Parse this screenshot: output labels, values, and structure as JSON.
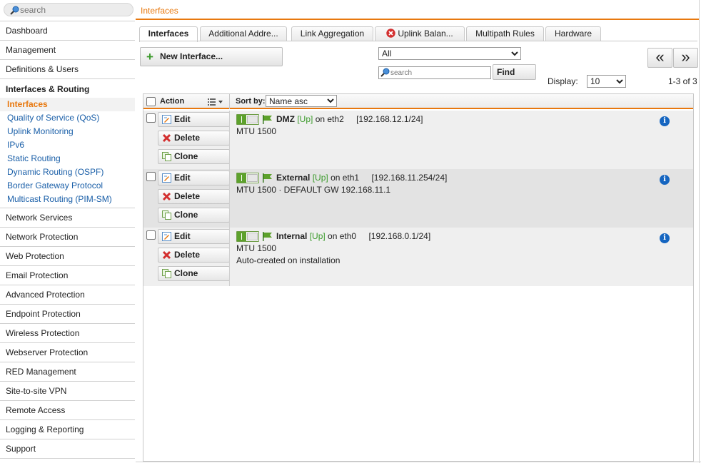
{
  "search": {
    "placeholder": "search"
  },
  "header": {
    "title": "Interfaces"
  },
  "sidebar": {
    "items_top": [
      {
        "label": "Dashboard"
      },
      {
        "label": "Management"
      },
      {
        "label": "Definitions & Users"
      }
    ],
    "group": {
      "label": "Interfaces & Routing",
      "subitems": [
        {
          "label": "Interfaces",
          "active": true
        },
        {
          "label": "Quality of Service (QoS)"
        },
        {
          "label": "Uplink Monitoring"
        },
        {
          "label": "IPv6"
        },
        {
          "label": "Static Routing"
        },
        {
          "label": "Dynamic Routing (OSPF)"
        },
        {
          "label": "Border Gateway Protocol"
        },
        {
          "label": "Multicast Routing (PIM-SM)"
        }
      ]
    },
    "items_bottom": [
      {
        "label": "Network Services"
      },
      {
        "label": "Network Protection"
      },
      {
        "label": "Web Protection"
      },
      {
        "label": "Email Protection"
      },
      {
        "label": "Advanced Protection"
      },
      {
        "label": "Endpoint Protection"
      },
      {
        "label": "Wireless Protection"
      },
      {
        "label": "Webserver Protection"
      },
      {
        "label": "RED Management"
      },
      {
        "label": "Site-to-site VPN"
      },
      {
        "label": "Remote Access"
      },
      {
        "label": "Logging & Reporting"
      },
      {
        "label": "Support"
      }
    ]
  },
  "tabs": [
    {
      "label": "Interfaces",
      "active": true
    },
    {
      "label": "Additional Addre..."
    },
    {
      "label": "Link Aggregation"
    },
    {
      "label": "Uplink Balan...",
      "icon": "error-icon"
    },
    {
      "label": "Multipath Rules"
    },
    {
      "label": "Hardware"
    }
  ],
  "toolbar": {
    "new_label": "New Interface...",
    "filter_value": "All",
    "search_placeholder": "search",
    "find_label": "Find",
    "display_label": "Display:",
    "display_value": "10",
    "pager_prev": "«",
    "pager_next": "»",
    "count": "1-3 of 3"
  },
  "table": {
    "action_header": "Action",
    "sort_label": "Sort by:",
    "sort_value": "Name asc",
    "edit_label": "Edit",
    "delete_label": "Delete",
    "clone_label": "Clone",
    "rows": [
      {
        "name": "DMZ",
        "status": "[Up]",
        "on": "on eth2",
        "address": "[192.168.12.1/24]",
        "detail1": "MTU 1500",
        "detail2": ""
      },
      {
        "name": "External",
        "status": "[Up]",
        "on": "on eth1",
        "address": "[192.168.11.254/24]",
        "detail1": "MTU 1500 · DEFAULT GW 192.168.11.1",
        "detail2": ""
      },
      {
        "name": "Internal",
        "status": "[Up]",
        "on": "on eth0",
        "address": "[192.168.0.1/24]",
        "detail1": "MTU 1500",
        "detail2": "Auto-created on installation"
      }
    ]
  },
  "colors": {
    "accent": "#e8780e",
    "link": "#1a5fa8",
    "status_up": "#3a9a2a",
    "info": "#1565c0"
  }
}
